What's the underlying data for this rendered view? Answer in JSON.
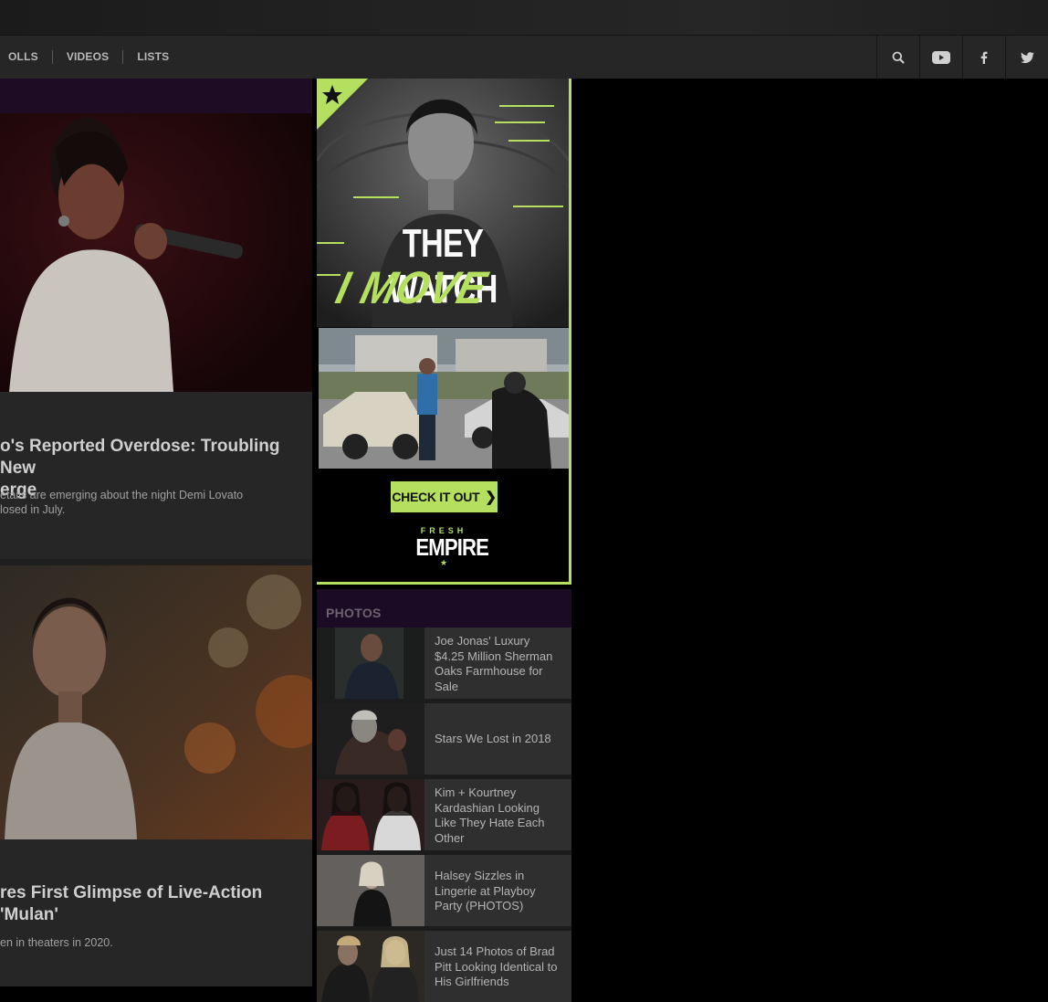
{
  "nav": {
    "links": [
      "OLLS",
      "VIDEOS",
      "LISTS"
    ],
    "icons": [
      "search-icon",
      "youtube-icon",
      "facebook-icon",
      "twitter-icon"
    ]
  },
  "articles": [
    {
      "title": "o's Reported Overdose: Troubling New\nerge",
      "excerpt": "etails are emerging about the night Demi Lovato\nlosed in July."
    },
    {
      "title": "res First Glimpse of Live-Action 'Mulan'",
      "excerpt": "en in theaters in 2020."
    }
  ],
  "ad": {
    "headline_1": "THEY WATCH",
    "headline_2": "I MOVE",
    "cta": "CHECK IT OUT",
    "logo_small": "FRESH",
    "logo_big": "EMPIRE",
    "colors": {
      "accent": "#b4df5f"
    }
  },
  "photos": {
    "heading": "PHOTOS",
    "items": [
      {
        "caption": "Joe Jonas' Luxury\n$4.25 Million Sherman\nOaks Farmhouse for\nSale"
      },
      {
        "caption": "Stars We Lost in 2018"
      },
      {
        "caption": "Kim + Kourtney\nKardashian Looking\nLike They Hate Each\nOther"
      },
      {
        "caption": "Halsey Sizzles in\nLingerie at Playboy\nParty (PHOTOS)"
      },
      {
        "caption": "Just 14 Photos of Brad\nPitt Looking Identical to\nHis Girlfriends"
      }
    ]
  }
}
